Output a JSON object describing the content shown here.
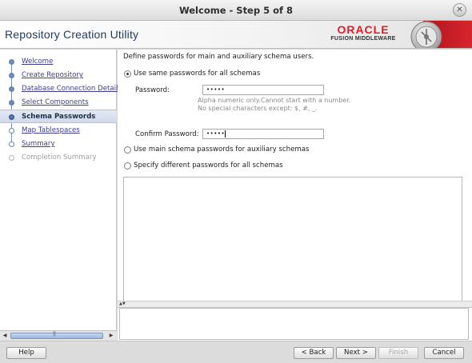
{
  "window": {
    "title": "Welcome - Step 5 of 8"
  },
  "header": {
    "app_title": "Repository Creation Utility",
    "logo_oracle": "ORACLE",
    "logo_subtitle": "FUSION MIDDLEWARE"
  },
  "nav": {
    "items": [
      {
        "label": "Welcome",
        "state": "done"
      },
      {
        "label": "Create Repository",
        "state": "done"
      },
      {
        "label": "Database Connection Details",
        "state": "done"
      },
      {
        "label": "Select Components",
        "state": "done"
      },
      {
        "label": "Schema Passwords",
        "state": "current"
      },
      {
        "label": "Map Tablespaces",
        "state": "todo"
      },
      {
        "label": "Summary",
        "state": "todo"
      },
      {
        "label": "Completion Summary",
        "state": "disabled"
      }
    ]
  },
  "main": {
    "intro": "Define passwords for main and auxiliary schema users.",
    "options": [
      {
        "label": "Use same passwords for all schemas",
        "checked": true
      },
      {
        "label": "Use main schema passwords for auxiliary schemas",
        "checked": false
      },
      {
        "label": "Specify different passwords for all schemas",
        "checked": false
      }
    ],
    "password_label": "Password:",
    "password_value": "•••••",
    "hint_line1": "Alpha numeric only.Cannot start with a number.",
    "hint_line2": "No special characters except: $, #, _.",
    "confirm_label": "Confirm Password:",
    "confirm_value": "•••••"
  },
  "footer": {
    "help": "Help",
    "back": "< Back",
    "next": "Next >",
    "finish": "Finish",
    "cancel": "Cancel"
  },
  "colors": {
    "oracle_red": "#e01e24",
    "title_blue": "#1c3c66",
    "link_purple": "#3d3d8c"
  },
  "icons": [
    "close-icon",
    "oracle-logo-graphic",
    "scroll-left-icon",
    "scroll-right-icon"
  ]
}
